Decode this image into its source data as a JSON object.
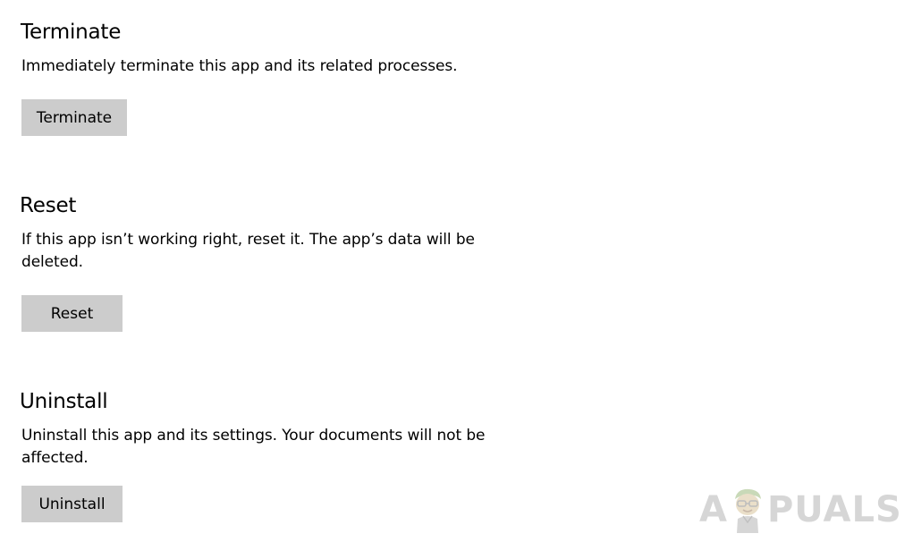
{
  "sections": {
    "terminate": {
      "title": "Terminate",
      "description": "Immediately terminate this app and its related processes.",
      "button_label": "Terminate"
    },
    "reset": {
      "title": "Reset",
      "description": "If this app isn’t working right, reset it. The app’s data will be deleted.",
      "button_label": "Reset"
    },
    "uninstall": {
      "title": "Uninstall",
      "description": "Uninstall this app and its settings. Your documents will not be affected.",
      "button_label": "Uninstall"
    }
  },
  "watermark": {
    "text_left": "A",
    "text_right": "PUALS",
    "icon": "appuals-mascot-icon",
    "color": "#d6d6d6"
  },
  "colors": {
    "background": "#ffffff",
    "button_background": "#cccccc",
    "text": "#000000"
  }
}
